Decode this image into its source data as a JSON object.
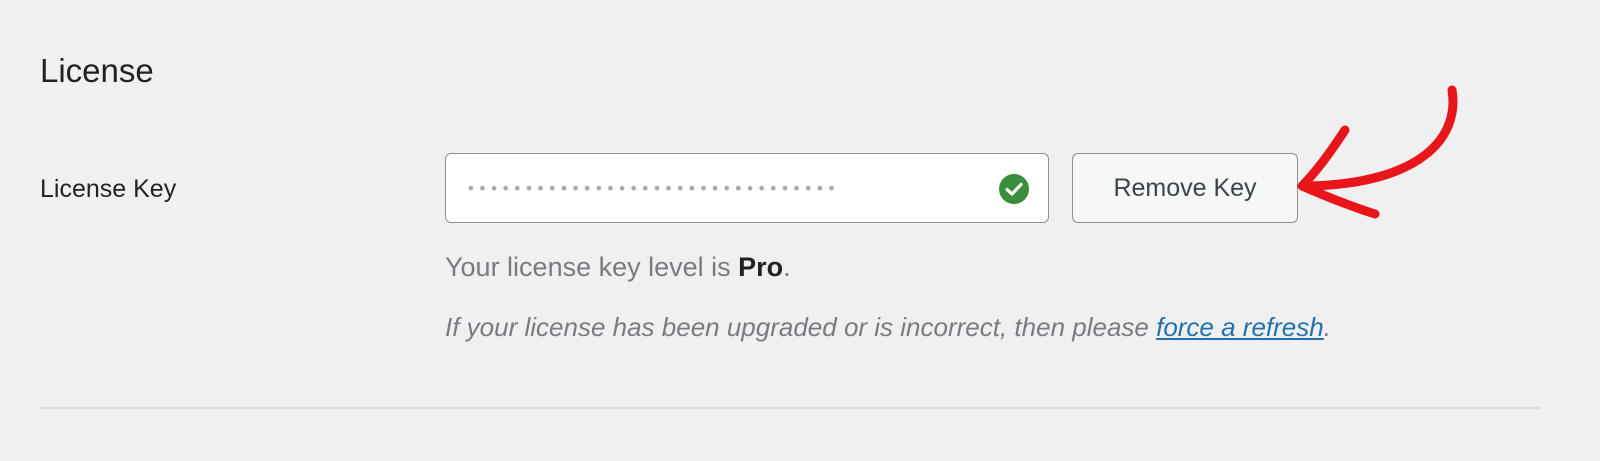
{
  "section": {
    "title": "License"
  },
  "license_key": {
    "label": "License Key",
    "masked_value": "••••••••••••••••••••••••••••••••",
    "status_icon": "check-circle-icon",
    "status_color": "#3a8d3a"
  },
  "remove_button": {
    "label": "Remove Key"
  },
  "level": {
    "prefix": "Your license key level is ",
    "value": "Pro",
    "suffix": "."
  },
  "refresh": {
    "prefix": "If your license has been upgraded or is incorrect, then please ",
    "link_text": "force a refresh",
    "suffix": "."
  },
  "annotation": {
    "arrow_color": "#e8151b",
    "arrow_icon": "red-arrow-annotation"
  },
  "colors": {
    "background": "#f0f0f1",
    "link": "#2271b1"
  }
}
